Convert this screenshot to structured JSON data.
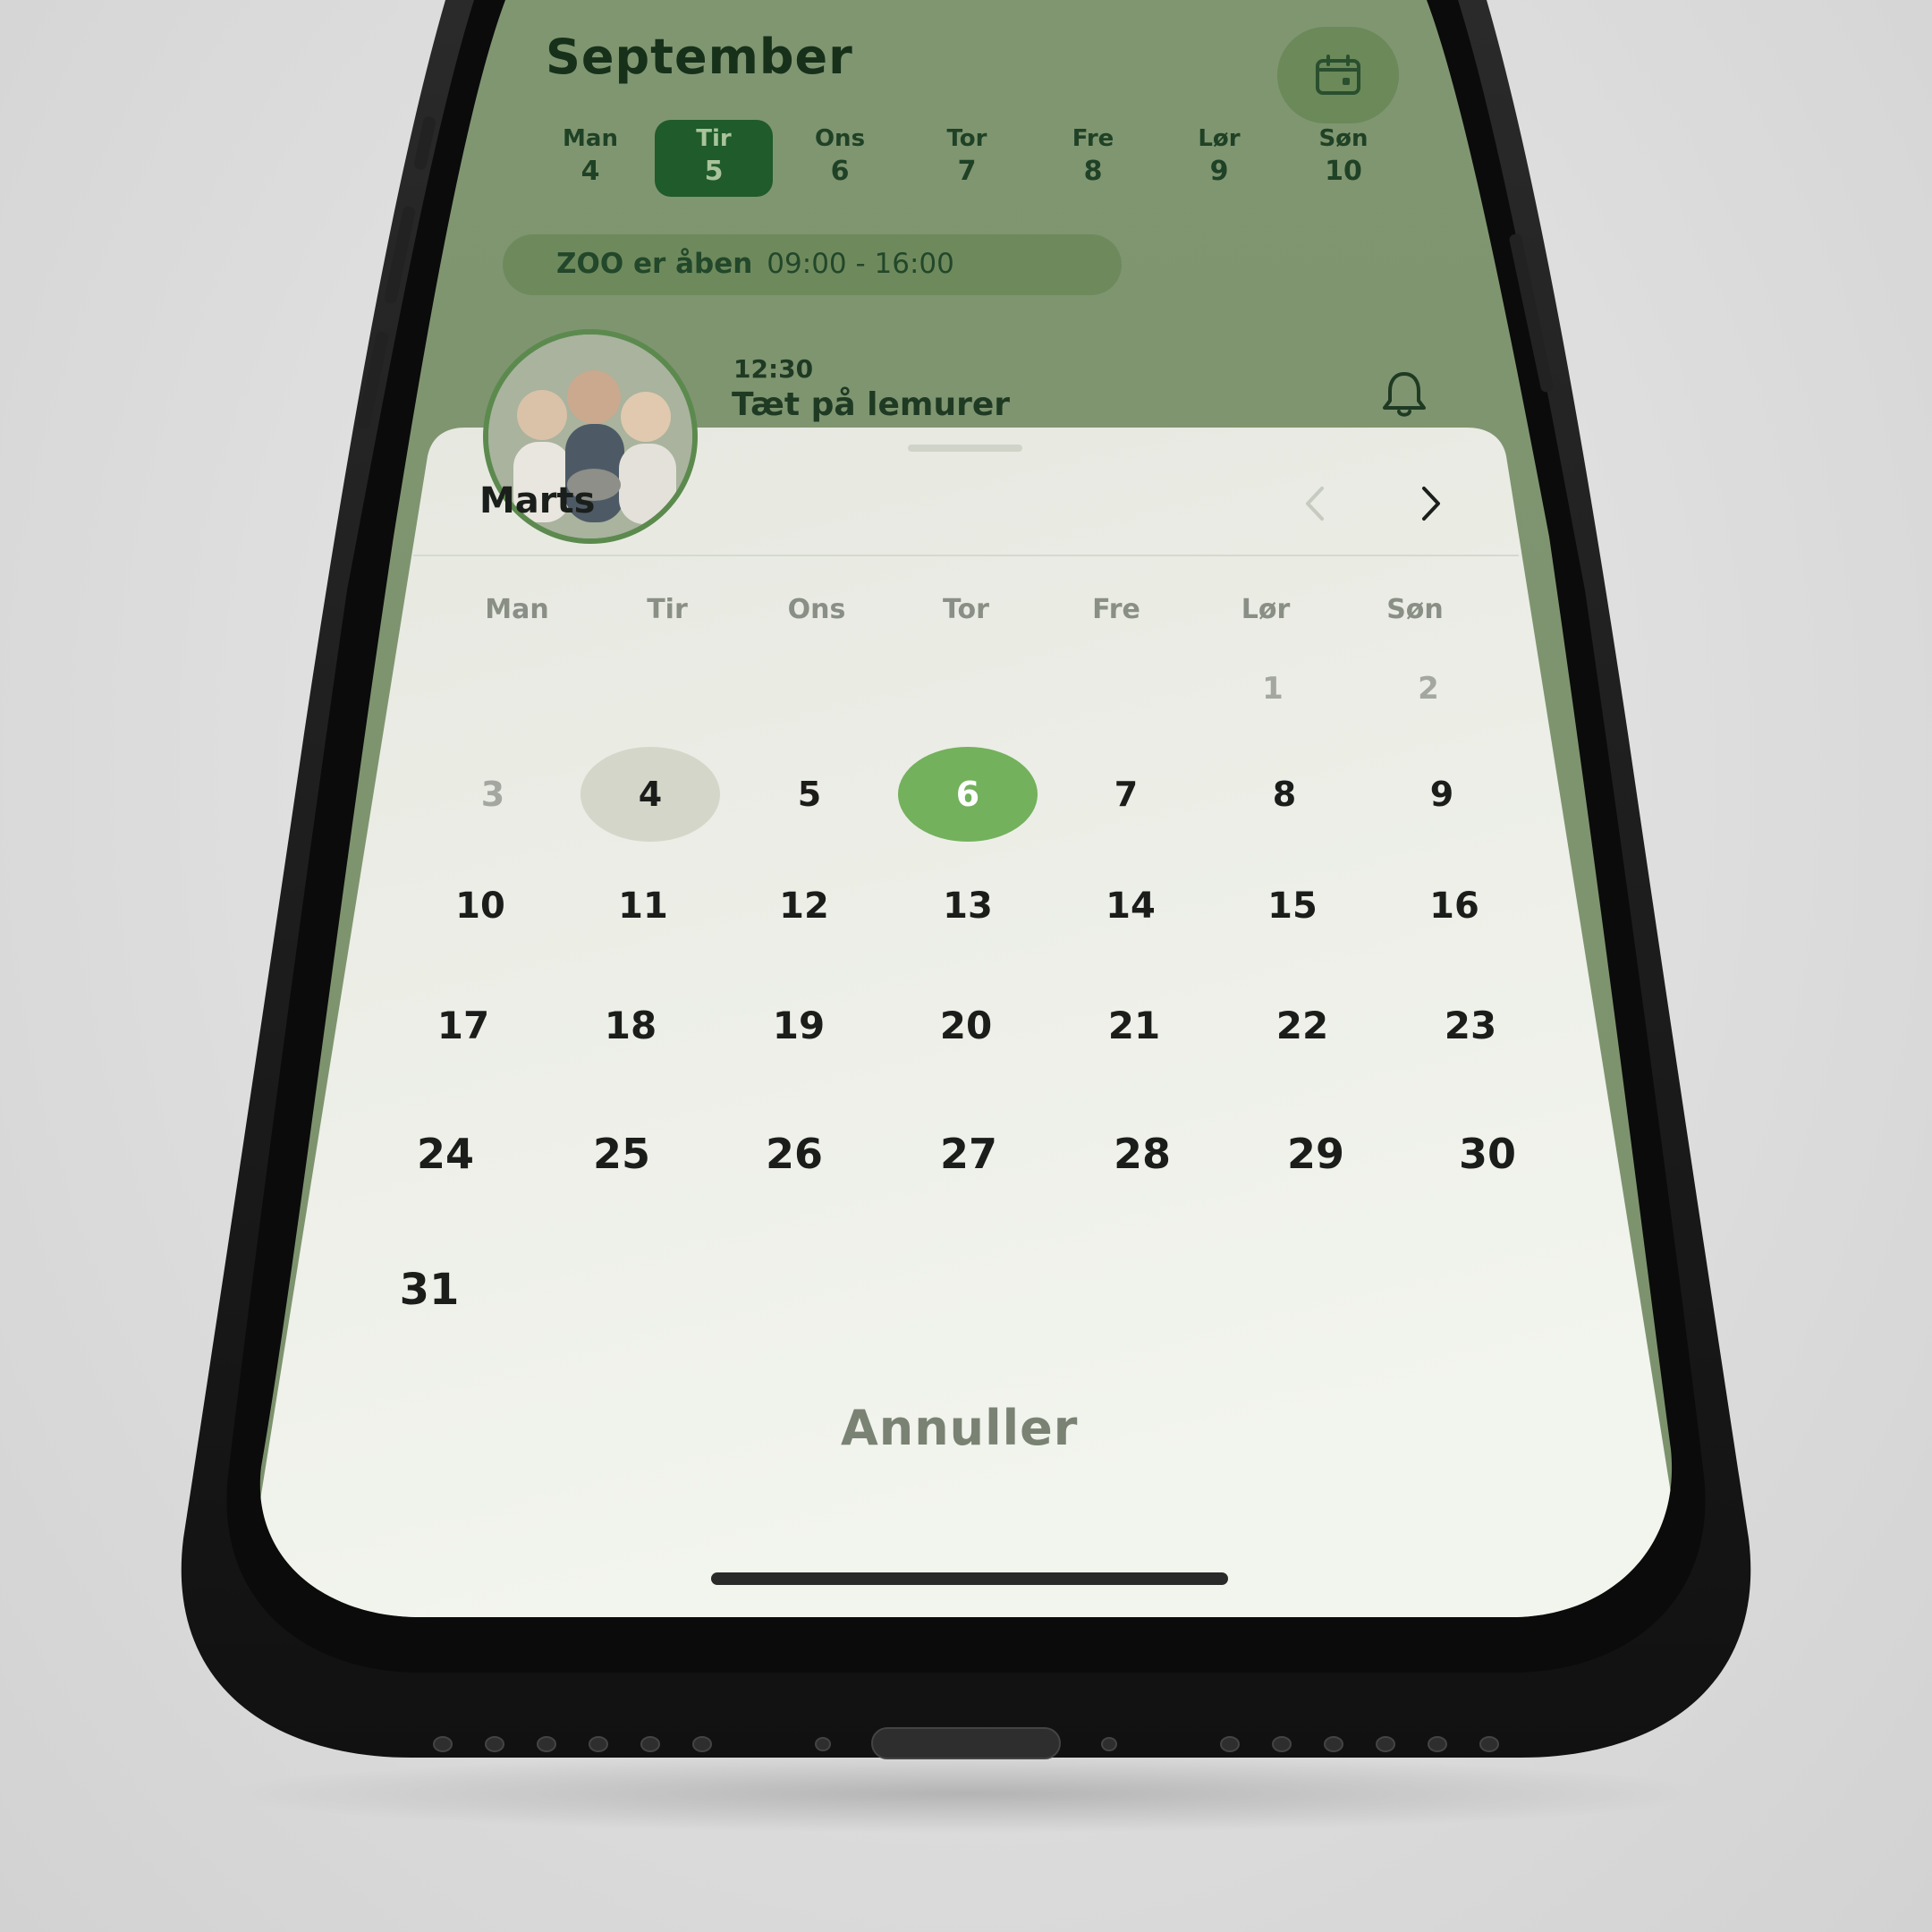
{
  "header": {
    "month": "September",
    "calendar_button_icon": "calendar-icon"
  },
  "week": [
    {
      "weekday": "Man",
      "day": "4",
      "selected": false
    },
    {
      "weekday": "Tir",
      "day": "5",
      "selected": true
    },
    {
      "weekday": "Ons",
      "day": "6",
      "selected": false
    },
    {
      "weekday": "Tor",
      "day": "7",
      "selected": false
    },
    {
      "weekday": "Fre",
      "day": "8",
      "selected": false
    },
    {
      "weekday": "Lør",
      "day": "9",
      "selected": false
    },
    {
      "weekday": "Søn",
      "day": "10",
      "selected": false
    }
  ],
  "hours": {
    "label": "ZOO er åben",
    "time": "09:00 - 16:00"
  },
  "event": {
    "time": "12:30",
    "title": "Tæt på lemurer",
    "notify_icon": "bell-icon"
  },
  "picker": {
    "month": "Marts",
    "prev_icon": "chevron-left-icon",
    "next_icon": "chevron-right-icon",
    "weekdays": [
      "Man",
      "Tir",
      "Ons",
      "Tor",
      "Fre",
      "Lør",
      "Søn"
    ],
    "rows": [
      [
        "",
        "",
        "",
        "",
        "",
        "1",
        "2"
      ],
      [
        "3",
        "4",
        "5",
        "6",
        "7",
        "8",
        "9"
      ],
      [
        "10",
        "11",
        "12",
        "13",
        "14",
        "15",
        "16"
      ],
      [
        "17",
        "18",
        "19",
        "20",
        "21",
        "22",
        "23"
      ],
      [
        "24",
        "25",
        "26",
        "27",
        "28",
        "29",
        "30"
      ],
      [
        "31",
        "",
        "",
        "",
        "",
        "",
        ""
      ]
    ],
    "muted_days": [
      "1",
      "2",
      "3"
    ],
    "today_day": "4",
    "selected_day": "6",
    "cancel_label": "Annuller"
  },
  "colors": {
    "header_bg": "#7e9370",
    "selected_week_bg": "#1f5b2b",
    "selected_day_bg": "#73b15c",
    "today_bg": "#d4d6c9",
    "sheet_bg": "#eaece5",
    "phone_frame": "#1c1c1c"
  }
}
